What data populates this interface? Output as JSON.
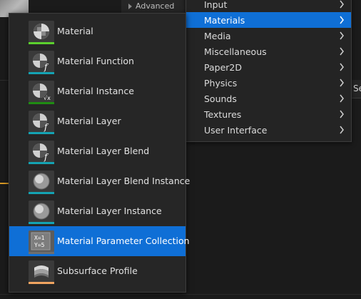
{
  "background": {
    "advanced_label": "Advanced",
    "right_panel_text": "Se"
  },
  "category_menu": {
    "items": [
      {
        "label": "Input",
        "selected": false
      },
      {
        "label": "Materials",
        "selected": true
      },
      {
        "label": "Media",
        "selected": false
      },
      {
        "label": "Miscellaneous",
        "selected": false
      },
      {
        "label": "Paper2D",
        "selected": false
      },
      {
        "label": "Physics",
        "selected": false
      },
      {
        "label": "Sounds",
        "selected": false
      },
      {
        "label": "Textures",
        "selected": false
      },
      {
        "label": "User Interface",
        "selected": false
      }
    ]
  },
  "asset_menu": {
    "items": [
      {
        "label": "Material",
        "icon": "material-icon",
        "bar_color": "#5bd02e",
        "selected": false
      },
      {
        "label": "Material Function",
        "icon": "material-function-icon",
        "bar_color": "#14a3b3",
        "selected": false
      },
      {
        "label": "Material Instance",
        "icon": "material-instance-icon",
        "bar_color": "#1f8c12",
        "selected": false
      },
      {
        "label": "Material Layer",
        "icon": "material-layer-icon",
        "bar_color": "#14a3b3",
        "selected": false
      },
      {
        "label": "Material Layer Blend",
        "icon": "material-layer-blend-icon",
        "bar_color": "#14a3b3",
        "selected": false
      },
      {
        "label": "Material Layer Blend Instance",
        "icon": "material-layer-blend-instance-icon",
        "bar_color": "#14a3b3",
        "selected": false
      },
      {
        "label": "Material Layer Instance",
        "icon": "material-layer-instance-icon",
        "bar_color": "#14a3b3",
        "selected": false
      },
      {
        "label": "Material Parameter Collection",
        "icon": "material-parameter-collection-icon",
        "bar_color": "#6e6e6e",
        "selected": true
      },
      {
        "label": "Subsurface Profile",
        "icon": "subsurface-profile-icon",
        "bar_color": "#f0a460",
        "selected": false
      }
    ]
  },
  "colors": {
    "selection": "#0f6fd6",
    "menu_bg": "#262626",
    "border": "#3c3c3c"
  }
}
